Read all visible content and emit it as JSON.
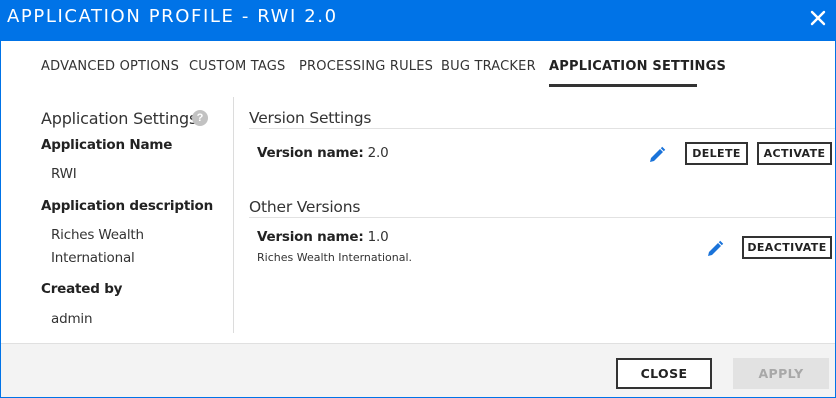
{
  "window": {
    "title": "APPLICATION PROFILE - RWI 2.0",
    "close_icon": "close-icon",
    "accent_color": "#0073e7"
  },
  "tabs": [
    {
      "label": "ADVANCED OPTIONS",
      "active": false
    },
    {
      "label": "CUSTOM TAGS",
      "active": false
    },
    {
      "label": "PROCESSING RULES",
      "active": false
    },
    {
      "label": "BUG TRACKER",
      "active": false
    },
    {
      "label": "APPLICATION SETTINGS",
      "active": true
    }
  ],
  "sidebar": {
    "title": "Application Settings",
    "help_icon": "?",
    "app_name_label": "Application Name",
    "app_name_value": "RWI",
    "app_desc_label": "Application description",
    "app_desc_line1": "Riches Wealth",
    "app_desc_line2": "International",
    "created_by_label": "Created by",
    "created_by_value": "admin"
  },
  "version_settings": {
    "heading": "Version Settings",
    "name_label": "Version name:",
    "name_value": "2.0",
    "edit_icon": "pencil-icon",
    "delete_label": "DELETE",
    "activate_label": "ACTIVATE"
  },
  "other_versions": {
    "heading": "Other Versions",
    "items": [
      {
        "name_label": "Version name:",
        "name_value": "1.0",
        "description": "Riches Wealth International.",
        "edit_icon": "pencil-icon",
        "deactivate_label": "DEACTIVATE"
      }
    ]
  },
  "footer": {
    "close_label": "CLOSE",
    "apply_label": "APPLY",
    "apply_enabled": false
  }
}
